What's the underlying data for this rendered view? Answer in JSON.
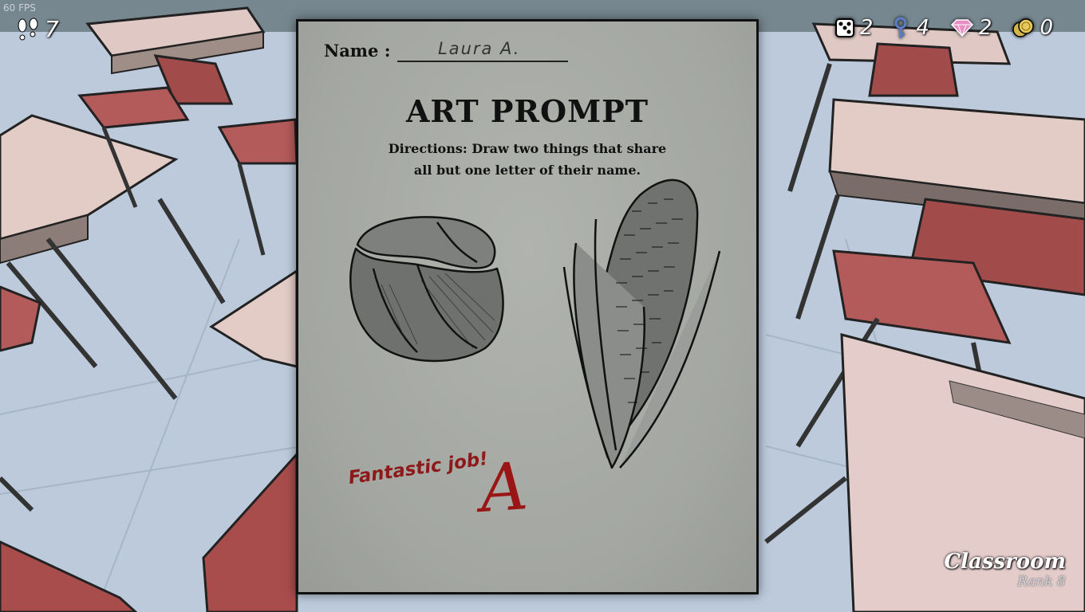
{
  "hud": {
    "fps": "60 FPS",
    "steps": "7",
    "dice": "2",
    "keys": "4",
    "gems": "2",
    "coins": "0"
  },
  "paper": {
    "name_label": "Name :",
    "name_value": "Laura A.",
    "title": "ART PROMPT",
    "directions_line1": "Directions: Draw two things that share",
    "directions_line2": "all but one letter of their name.",
    "comment": "Fantastic job!",
    "grade": "A"
  },
  "location": {
    "name": "Classroom",
    "rank": "Rank 8"
  },
  "icons": [
    "footsteps-icon",
    "dice-icon",
    "key-icon",
    "gem-icon",
    "coins-icon"
  ],
  "colors": {
    "grade_red": "#9a1515",
    "paper": "#a5a8a3"
  }
}
